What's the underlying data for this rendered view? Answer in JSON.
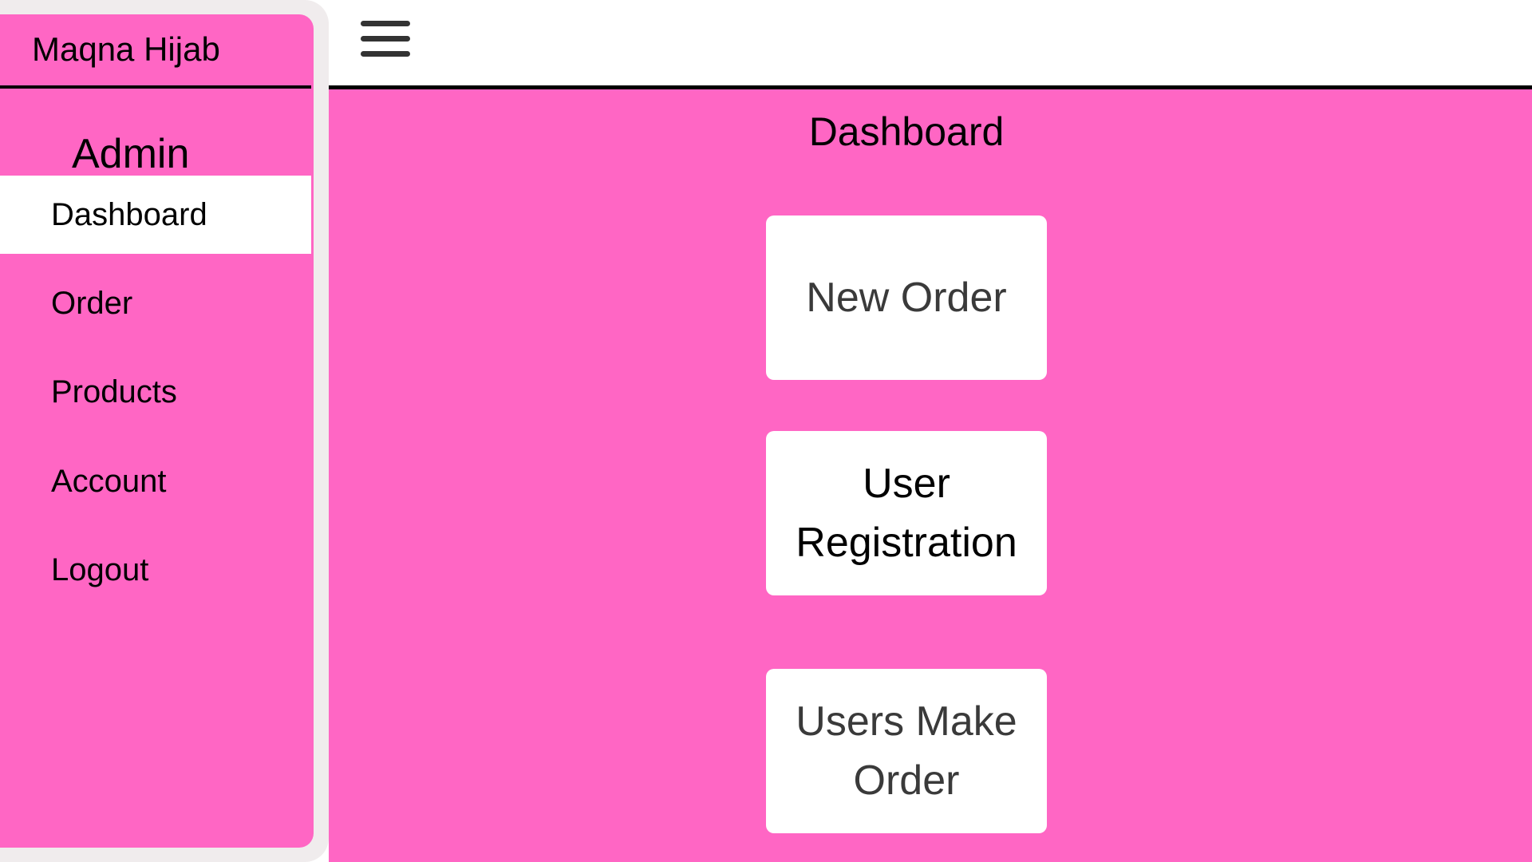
{
  "sidebar": {
    "brand": "Maqna Hijab",
    "role": "Admin",
    "items": [
      {
        "label": "Dashboard",
        "active": true
      },
      {
        "label": "Order",
        "active": false
      },
      {
        "label": "Products",
        "active": false
      },
      {
        "label": "Account",
        "active": false
      },
      {
        "label": "Logout",
        "active": false
      }
    ]
  },
  "topbar": {
    "menu_icon": "hamburger-menu-icon"
  },
  "main": {
    "title": "Dashboard",
    "cards": [
      {
        "label": "New Order"
      },
      {
        "label": "User Registration"
      },
      {
        "label": "Users Make Order"
      }
    ]
  },
  "colors": {
    "accent": "#ff66c4",
    "sidebar_frame": "#f0eced",
    "card_bg": "#ffffff",
    "divider": "#000000"
  }
}
